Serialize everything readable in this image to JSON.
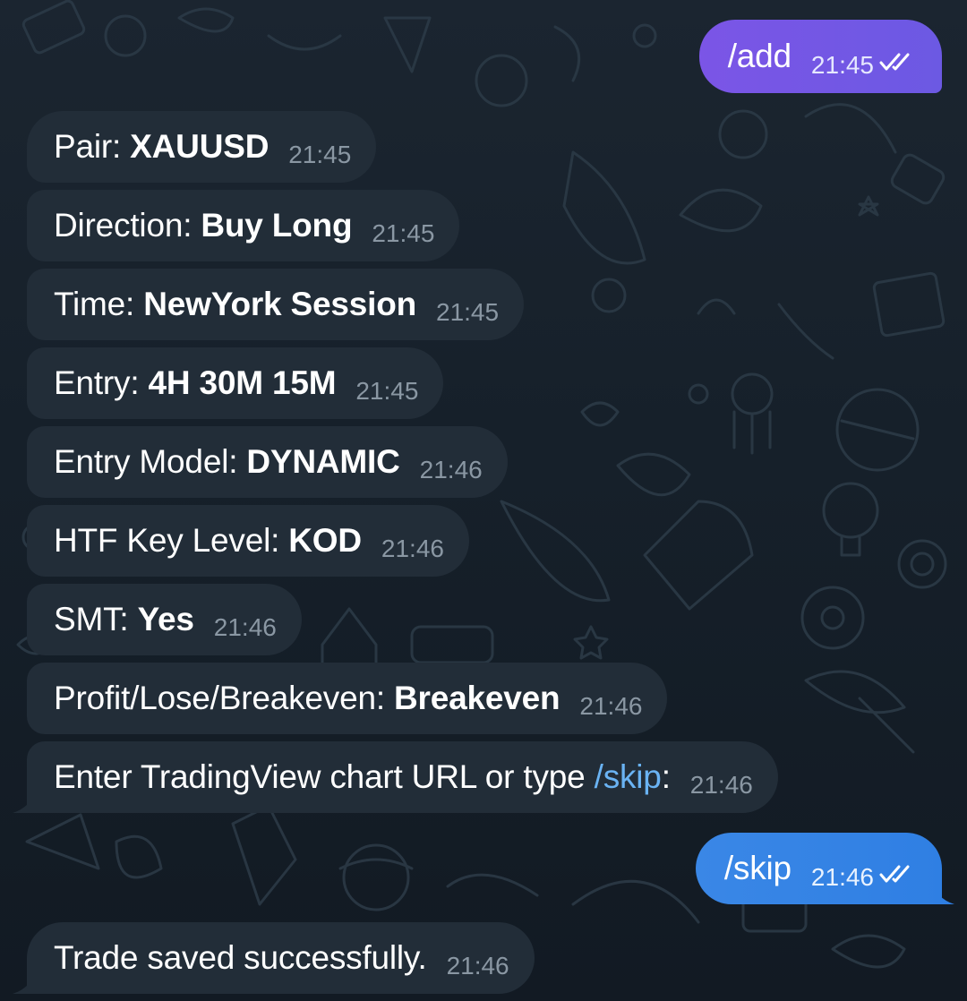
{
  "messages": [
    {
      "label": "",
      "value": "/add",
      "time": "21:45"
    },
    {
      "label": "Pair:",
      "value": "XAUUSD",
      "time": "21:45"
    },
    {
      "label": "Direction:",
      "value": "Buy Long",
      "time": "21:45"
    },
    {
      "label": "Time:",
      "value": "NewYork Session",
      "time": "21:45"
    },
    {
      "label": "Entry:",
      "value": "4H 30M 15M",
      "time": "21:45"
    },
    {
      "label": "Entry Model:",
      "value": "DYNAMIC",
      "time": "21:46"
    },
    {
      "label": "HTF Key Level:",
      "value": "KOD",
      "time": "21:46"
    },
    {
      "label": "SMT:",
      "value": "Yes",
      "time": "21:46"
    },
    {
      "label": "Profit/Lose/Breakeven:",
      "value": "Breakeven",
      "time": "21:46"
    },
    {
      "label": "Enter TradingView chart URL or type",
      "value": "/skip",
      "suffix": ":",
      "time": "21:46"
    },
    {
      "label": "",
      "value": "/skip",
      "time": "21:46"
    },
    {
      "label": "Trade saved successfully.",
      "value": "",
      "time": "21:46"
    }
  ],
  "icons": {
    "read_receipt": "double-check-icon"
  },
  "colors": {
    "background": "#17212b",
    "incoming_bubble": "#222d38",
    "outgoing_purple": "#7257e5",
    "outgoing_blue": "#3584e4",
    "command_link": "#6ab3f3"
  }
}
